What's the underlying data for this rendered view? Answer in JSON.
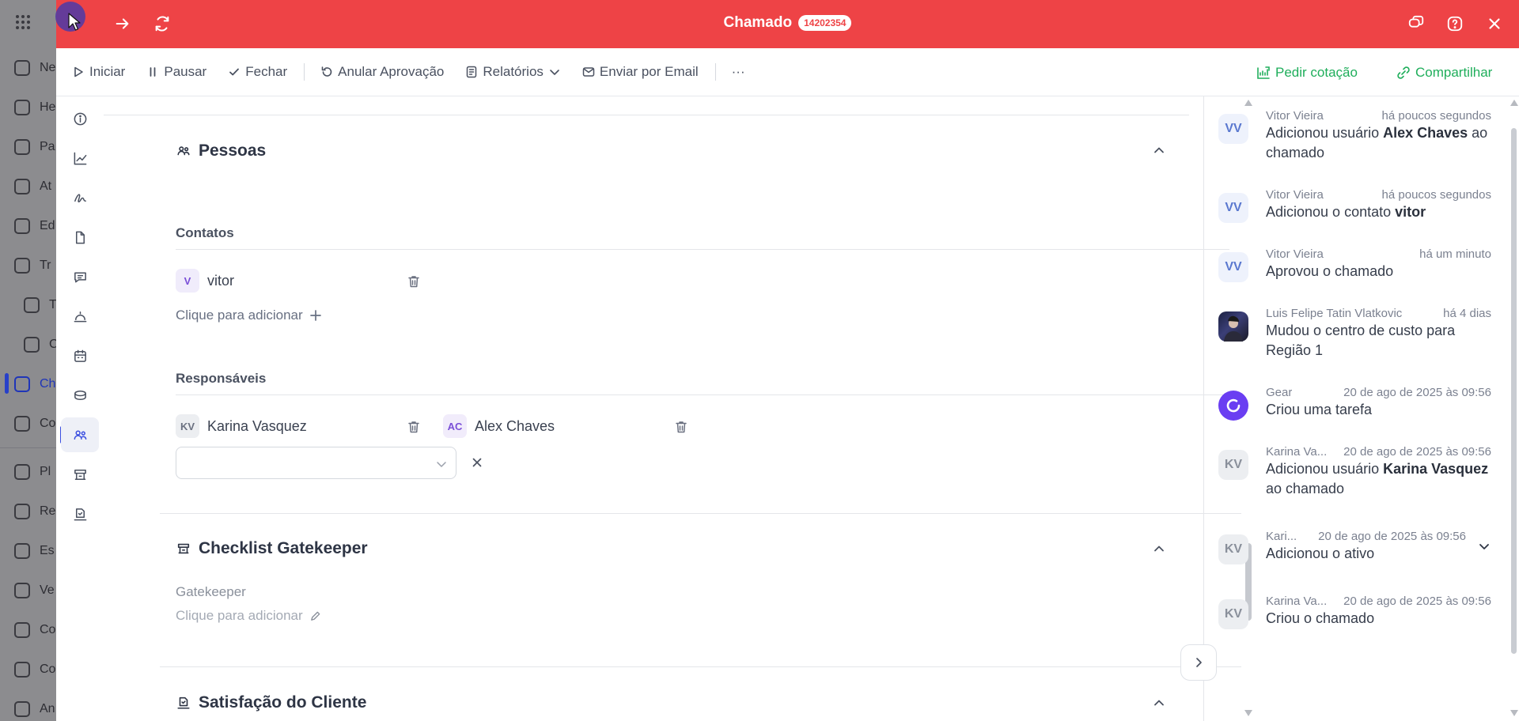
{
  "background_nav": {
    "items": [
      {
        "label": "Ne"
      },
      {
        "label": "He"
      },
      {
        "label": "Pa"
      },
      {
        "label": "At"
      },
      {
        "label": "Ed"
      },
      {
        "label": "Tr"
      },
      {
        "label": "T"
      },
      {
        "label": "C"
      },
      {
        "label": "Ch"
      },
      {
        "label": "Co"
      },
      {
        "label": "Pl"
      },
      {
        "label": "Re"
      },
      {
        "label": "Es"
      },
      {
        "label": "Ve"
      },
      {
        "label": "Co"
      },
      {
        "label": "Co"
      },
      {
        "label": "An"
      }
    ]
  },
  "header": {
    "title": "Chamado",
    "ticket_number": "14202354",
    "icons": [
      "grid-icon",
      "arrow-right-icon",
      "refresh-icon",
      "chat-icon",
      "help-icon",
      "close-icon"
    ]
  },
  "toolbar": {
    "start": "Iniciar",
    "pause": "Pausar",
    "close": "Fechar",
    "undo_approval": "Anular Aprovação",
    "reports": "Relatórios",
    "send_email": "Enviar por Email",
    "more": "···",
    "request_quote": "Pedir cotação",
    "share": "Compartilhar"
  },
  "sections": {
    "people": {
      "title": "Pessoas",
      "contacts_title": "Contatos",
      "contacts": [
        {
          "initials": "V",
          "name": "vitor"
        }
      ],
      "add_contact": "Clique para adicionar",
      "responsibles_title": "Responsáveis",
      "responsibles": [
        {
          "initials": "KV",
          "name": "Karina Vasquez"
        },
        {
          "initials": "AC",
          "name": "Alex Chaves"
        }
      ]
    },
    "checklist": {
      "title": "Checklist Gatekeeper",
      "field_label": "Gatekeeper",
      "add_text": "Clique para adicionar"
    },
    "satisfaction": {
      "title": "Satisfação do Cliente"
    }
  },
  "feed": [
    {
      "initials": "VV",
      "author": "Vitor Vieira",
      "time": "há poucos segundos",
      "text_before": "Adicionou usuário ",
      "bold": "Alex Chaves",
      "text_after": " ao chamado"
    },
    {
      "initials": "VV",
      "author": "Vitor Vieira",
      "time": "há poucos segundos",
      "text_before": "Adicionou o contato ",
      "bold": "vitor",
      "text_after": ""
    },
    {
      "initials": "VV",
      "author": "Vitor Vieira",
      "time": "há um minuto",
      "text_before": "Aprovou o chamado",
      "bold": "",
      "text_after": ""
    },
    {
      "initials": "",
      "author": "Luis Felipe Tatin Vlatkovic",
      "time": "há 4 dias",
      "text_before": "Mudou o centro de custo para Região 1",
      "bold": "",
      "text_after": ""
    },
    {
      "initials": "",
      "author": "Gear",
      "time": "20 de ago de 2025 às 09:56",
      "text_before": "Criou uma tarefa",
      "bold": "",
      "text_after": ""
    },
    {
      "initials": "KV",
      "author": "Karina Va...",
      "time": "20 de ago de 2025 às 09:56",
      "text_before": "Adicionou usuário ",
      "bold": "Karina Vasquez",
      "text_after": " ao chamado"
    },
    {
      "initials": "KV",
      "author": "Kari...",
      "time": "20 de ago de 2025 às 09:56",
      "text_before": "Adicionou o ativo",
      "bold": "",
      "text_after": ""
    },
    {
      "initials": "KV",
      "author": "Karina Va...",
      "time": "20 de ago de 2025 às 09:56",
      "text_before": "Criou o chamado",
      "bold": "",
      "text_after": ""
    }
  ],
  "colors": {
    "header_bg": "#ee4346",
    "accent_green": "#1fae5b",
    "rail_indicator": "#3b4fe0"
  }
}
